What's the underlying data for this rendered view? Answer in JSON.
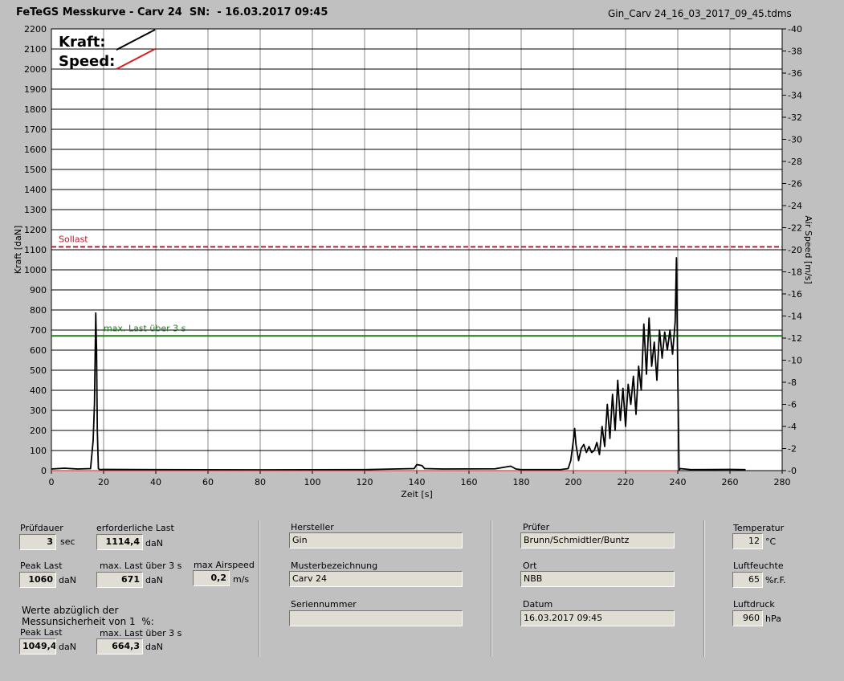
{
  "header": {
    "title": "FeTeGS Messkurve - Carv 24  SN:  - 16.03.2017 09:45",
    "filename": "Gin_Carv 24_16_03_2017_09_45.tdms"
  },
  "chart_data": {
    "type": "line",
    "xlabel": "Zeit [s]",
    "ylabel": "Kraft [daN]",
    "y2label": "Air Speed [m/s]",
    "xlim": [
      0,
      280
    ],
    "ylim": [
      0,
      2200
    ],
    "y2lim": [
      0,
      40
    ],
    "xticks": [
      0,
      20,
      40,
      60,
      80,
      100,
      120,
      140,
      160,
      180,
      200,
      220,
      240,
      260,
      280
    ],
    "yticks": [
      0,
      100,
      200,
      300,
      400,
      500,
      600,
      700,
      800,
      900,
      1000,
      1100,
      1200,
      1300,
      1400,
      1500,
      1600,
      1700,
      1800,
      1900,
      2000,
      2100,
      2200
    ],
    "y2ticks": [
      0,
      2,
      4,
      6,
      8,
      10,
      12,
      14,
      16,
      18,
      20,
      22,
      24,
      26,
      28,
      30,
      32,
      34,
      36,
      38,
      40
    ],
    "grid": true,
    "legend": [
      {
        "name": "Kraft",
        "color": "#000000"
      },
      {
        "name": "Speed",
        "color": "#d42020"
      }
    ],
    "reference_lines": [
      {
        "label": "Sollast",
        "y": 1114.4,
        "color": "#b02030",
        "style": "dashed"
      },
      {
        "label": "max. Last über  3 s",
        "y": 671,
        "color": "#1a7a1a",
        "style": "solid"
      }
    ],
    "series": [
      {
        "name": "Kraft",
        "color": "#000000",
        "x": [
          0,
          5,
          10,
          15,
          16,
          16.5,
          17,
          17.3,
          17.6,
          18,
          18.5,
          20,
          40,
          80,
          120,
          139,
          140,
          142,
          143,
          150,
          170,
          175,
          176,
          178,
          180,
          195,
          198,
          199,
          200,
          200.5,
          201,
          202,
          203,
          204,
          205,
          206,
          207,
          208,
          209,
          210,
          211,
          212,
          213,
          214,
          215,
          216,
          217,
          218,
          219,
          220,
          221,
          222,
          223,
          224,
          225,
          226,
          227,
          228,
          229,
          230,
          231,
          232,
          233,
          234,
          235,
          236,
          237,
          238,
          239,
          239.5,
          240,
          240.5,
          241,
          245,
          260,
          266
        ],
        "y": [
          8,
          12,
          8,
          10,
          150,
          330,
          785,
          600,
          200,
          10,
          5,
          6,
          5,
          4,
          5,
          10,
          30,
          25,
          10,
          8,
          9,
          20,
          22,
          8,
          5,
          5,
          10,
          50,
          150,
          210,
          130,
          50,
          110,
          130,
          90,
          120,
          90,
          100,
          140,
          80,
          220,
          120,
          330,
          160,
          380,
          200,
          450,
          250,
          410,
          220,
          430,
          330,
          470,
          280,
          520,
          400,
          730,
          480,
          760,
          520,
          640,
          450,
          700,
          560,
          690,
          600,
          700,
          580,
          740,
          1060,
          470,
          5,
          10,
          5,
          6,
          5
        ]
      },
      {
        "name": "Speed",
        "color": "#d42020",
        "x": [
          0,
          240
        ],
        "y": [
          0,
          0
        ]
      }
    ]
  },
  "panel": {
    "pruefdauer": {
      "label": "Prüfdauer",
      "value": "3",
      "unit": "sec"
    },
    "erf_last": {
      "label": "erforderliche Last",
      "value": "1114,4",
      "unit": "daN"
    },
    "peak_last": {
      "label": "Peak Last",
      "value": "1060",
      "unit": "daN"
    },
    "max_last": {
      "label": "max. Last über  3 s",
      "value": "671",
      "unit": "daN"
    },
    "max_airspeed": {
      "label": "max Airspeed",
      "value": "0,2",
      "unit": "m/s"
    },
    "note": "Werte abzüglich der\nMessunsicherheit von 1  %:",
    "peak_last2": {
      "label": "Peak Last",
      "value": "1049,4",
      "unit": "daN"
    },
    "max_last2": {
      "label": "max. Last über  3 s",
      "value": "664,3",
      "unit": "daN"
    },
    "hersteller": {
      "label": "Hersteller",
      "value": "Gin"
    },
    "muster": {
      "label": "Musterbezeichnung",
      "value": "Carv 24"
    },
    "serien": {
      "label": "Seriennummer",
      "value": ""
    },
    "pruefer": {
      "label": "Prüfer",
      "value": "Brunn/Schmidtler/Buntz"
    },
    "ort": {
      "label": "Ort",
      "value": "NBB"
    },
    "datum": {
      "label": "Datum",
      "value": "16.03.2017 09:45"
    },
    "temperatur": {
      "label": "Temperatur",
      "value": "12",
      "unit": "°C"
    },
    "luftfeuchte": {
      "label": "Luftfeuchte",
      "value": "65",
      "unit": "%r.F."
    },
    "luftdruck": {
      "label": "Luftdruck",
      "value": "960",
      "unit": "hPa"
    }
  }
}
